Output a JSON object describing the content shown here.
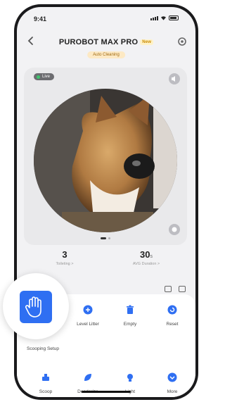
{
  "status_bar": {
    "time": "9:41"
  },
  "header": {
    "title": "PUROBOT MAX PRO",
    "badge": "New",
    "status": "Auto Cleaning"
  },
  "camera": {
    "live_label": "Live"
  },
  "stats": [
    {
      "value": "3",
      "unit": "",
      "label": "Toileting >"
    },
    {
      "value": "30",
      "unit": "s",
      "label": "AVG Duration >"
    }
  ],
  "actions": {
    "scooping_setup": "Scooping Setup",
    "level_litter": "Level Litter",
    "empty": "Empty",
    "reset": "Reset",
    "scoop": "Scoop",
    "deodorize": "Deodorize",
    "light": "Light",
    "more": "More"
  },
  "colors": {
    "accent": "#2f6ff2",
    "status_bg": "#fde9c4",
    "live_dot": "#3ec46d"
  }
}
